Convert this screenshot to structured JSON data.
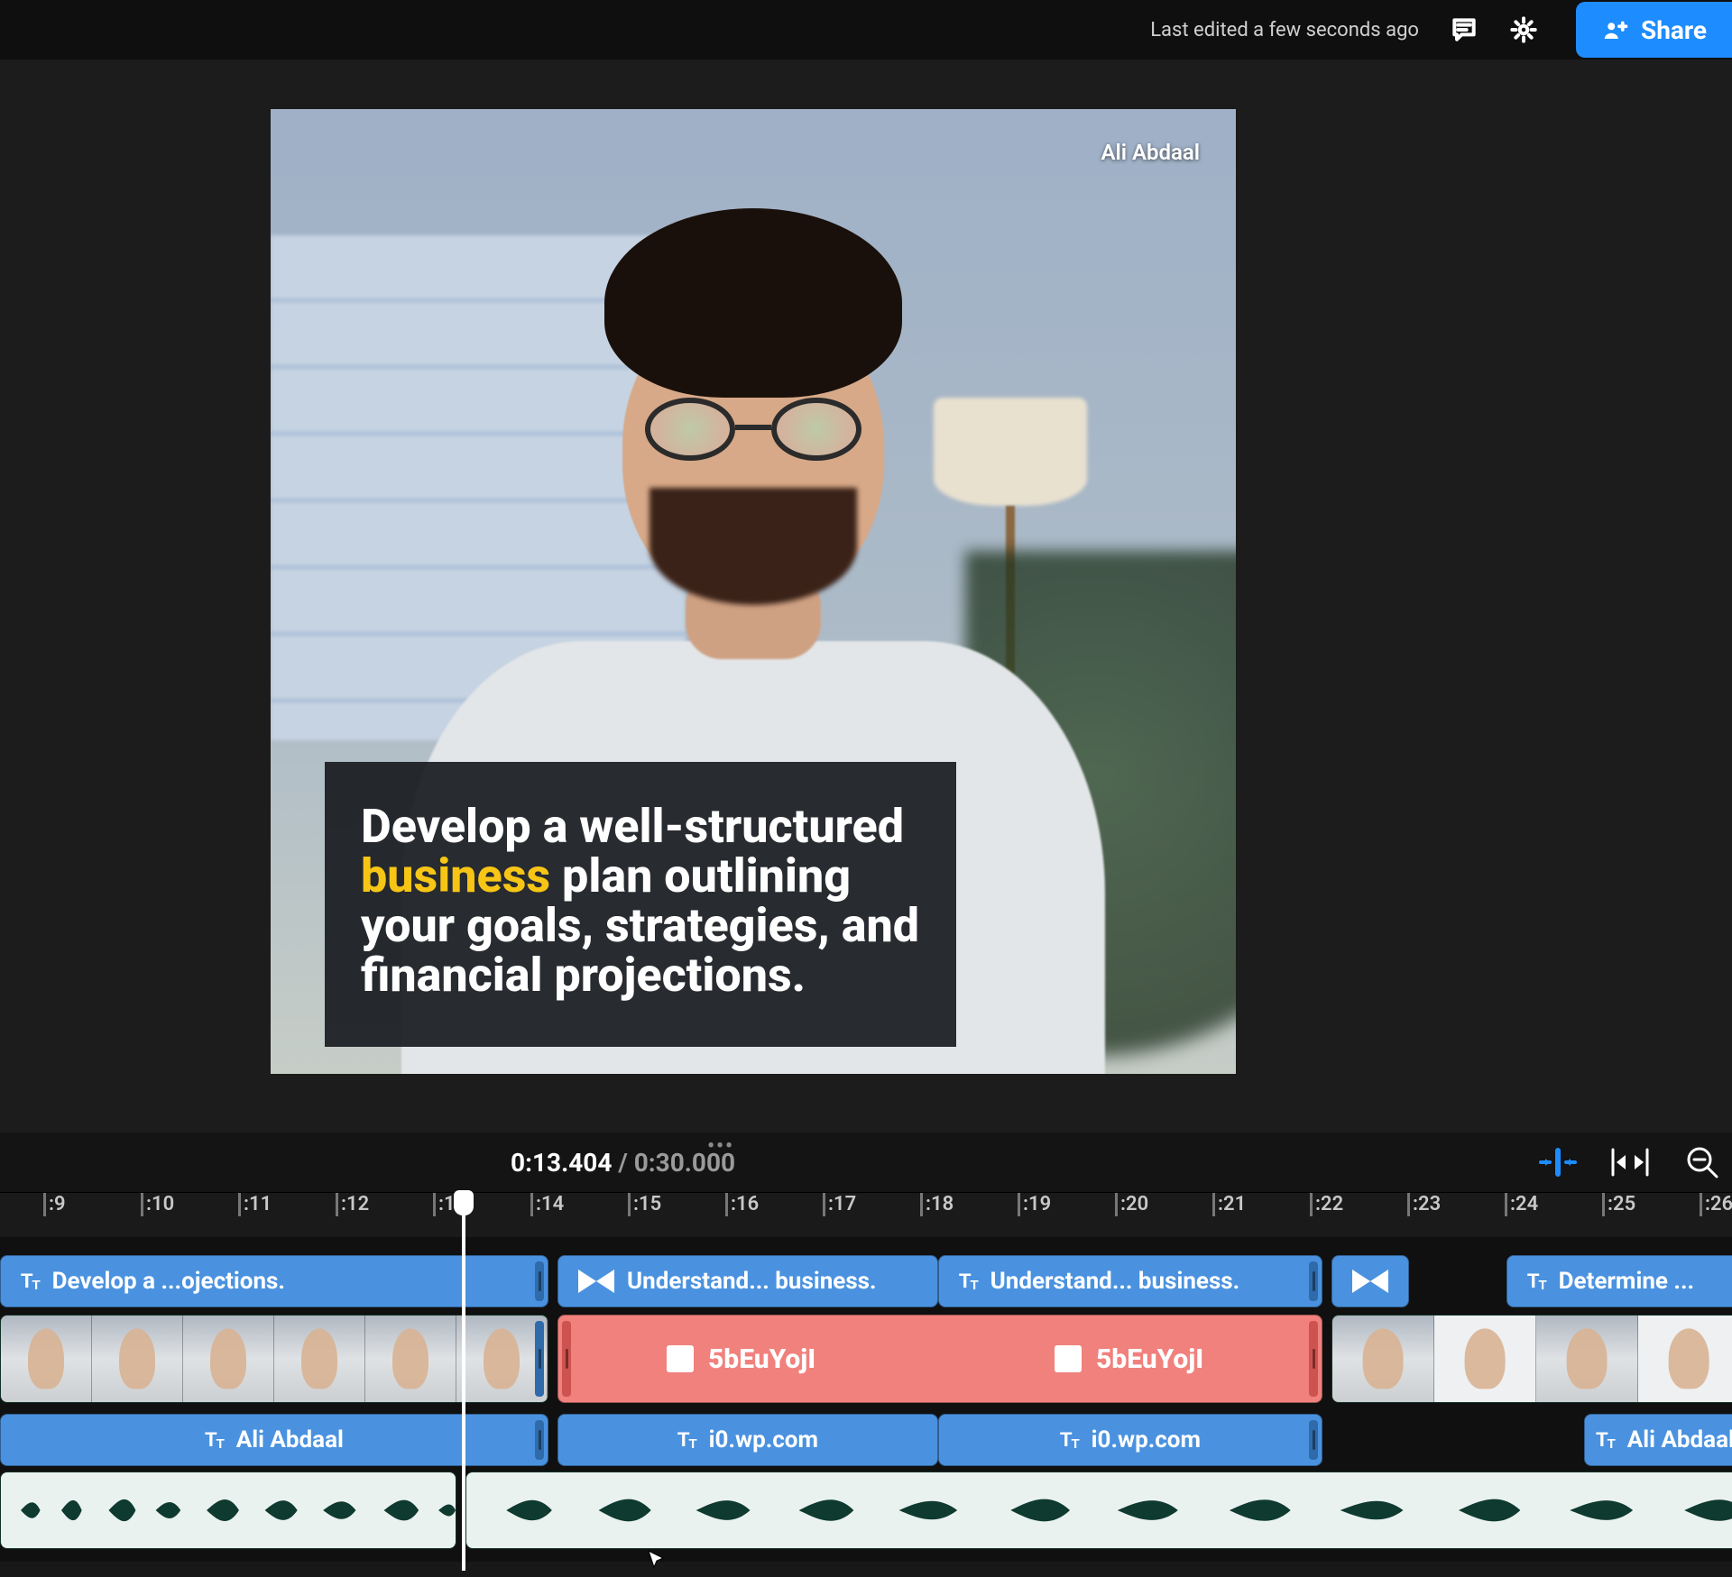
{
  "header": {
    "last_edited": "Last edited a few seconds ago",
    "share_label": "Share"
  },
  "preview": {
    "watermark": "Ali Abdaal",
    "caption_pre": "Develop a well-structured ",
    "caption_highlight": "business",
    "caption_post": " plan outlining your goals, strategies, and financial projections.",
    "colors": {
      "highlight": "#f6c516",
      "box_bg": "rgba(24,27,31,.92)"
    }
  },
  "playback": {
    "current_time": "0:13.404",
    "separator": " / ",
    "total_time": "0:30.000"
  },
  "ruler": {
    "labels": [
      ":9",
      ":10",
      ":11",
      ":12",
      ":13",
      ":14",
      ":15",
      ":16",
      ":17",
      ":18",
      ":19",
      ":20",
      ":21",
      ":22",
      ":23",
      ":24",
      ":25",
      ":26"
    ]
  },
  "timeline": {
    "text_clips": [
      {
        "label": "Develop a ...ojections."
      },
      {
        "label": "Understand... business."
      },
      {
        "label": "Understand... business."
      },
      {
        "label": "Determine ..."
      }
    ],
    "red_label": "5bEuYojI",
    "lower_clips": [
      {
        "label": "Ali Abdaal"
      },
      {
        "label": "i0.wp.com"
      },
      {
        "label": "i0.wp.com"
      },
      {
        "label": "Ali Abdaal"
      }
    ]
  }
}
